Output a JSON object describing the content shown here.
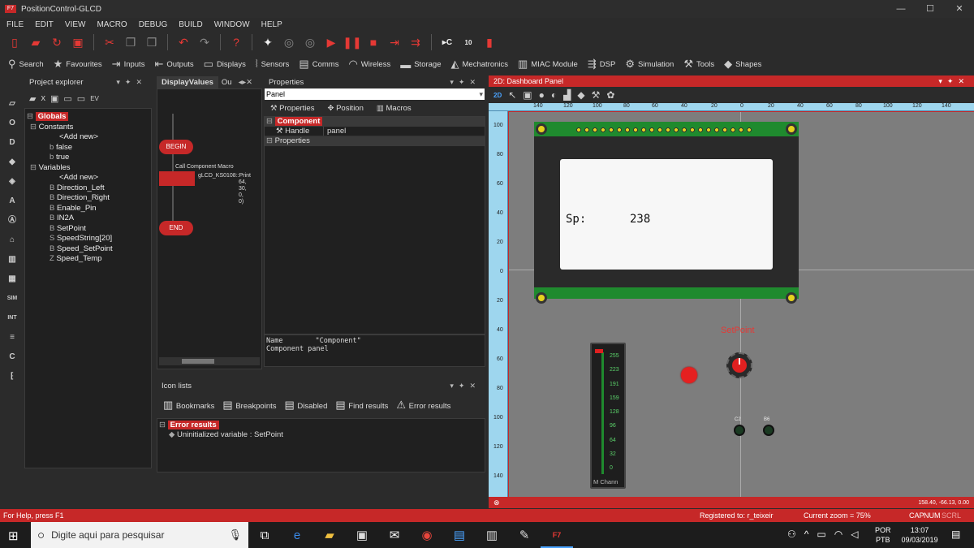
{
  "window": {
    "title": "PositionControl-GLCD",
    "min": "—",
    "max": "☐",
    "close": "✕"
  },
  "menu": [
    "FILE",
    "EDIT",
    "VIEW",
    "MACRO",
    "DEBUG",
    "BUILD",
    "WINDOW",
    "HELP"
  ],
  "toolbar2": [
    {
      "label": "Search",
      "icon": "search-icon"
    },
    {
      "label": "Favourites",
      "icon": "star-icon"
    },
    {
      "label": "Inputs",
      "icon": "inputs-icon"
    },
    {
      "label": "Outputs",
      "icon": "outputs-icon"
    },
    {
      "label": "Displays",
      "icon": "displays-icon"
    },
    {
      "label": "Sensors",
      "icon": "sensors-icon"
    },
    {
      "label": "Comms",
      "icon": "comms-icon"
    },
    {
      "label": "Wireless",
      "icon": "wireless-icon"
    },
    {
      "label": "Storage",
      "icon": "storage-icon"
    },
    {
      "label": "Mechatronics",
      "icon": "mechatronics-icon"
    },
    {
      "label": "MIAC Module",
      "icon": "miac-icon"
    },
    {
      "label": "DSP",
      "icon": "dsp-icon"
    },
    {
      "label": "Simulation",
      "icon": "gear-icon"
    },
    {
      "label": "Tools",
      "icon": "tools-icon"
    },
    {
      "label": "Shapes",
      "icon": "shapes-icon"
    }
  ],
  "project": {
    "title": "Project explorer",
    "globals": "Globals",
    "constants": "Constants",
    "const_items": [
      "<Add new>",
      "false",
      "true"
    ],
    "variables": "Variables",
    "var_items": [
      "<Add new>",
      "Direction_Left",
      "Direction_Right",
      "Enable_Pin",
      "IN2A",
      "SetPoint",
      "SpeedString[20]",
      "Speed_SetPoint",
      "Speed_Temp"
    ]
  },
  "flow": {
    "tab1": "DisplayValues",
    "tab2": "Ou",
    "begin": "BEGIN",
    "end": "END",
    "call_title": "Call Component Macro",
    "call_text": "gLCD_KS0108::Print",
    "call_args": [
      "64,",
      "30,",
      "0,",
      "0)"
    ]
  },
  "props": {
    "title": "Properties",
    "selected": "Panel",
    "tabs": [
      "Properties",
      "Position",
      "Macros"
    ],
    "component": "Component",
    "handle_label": "Handle",
    "handle_value": "panel",
    "properties": "Properties",
    "info_name": "Name",
    "info_value": "\"Component\"",
    "info_line2": "Component panel"
  },
  "iconlists": {
    "title": "Icon lists",
    "tabs": [
      "Bookmarks",
      "Breakpoints",
      "Disabled",
      "Find results",
      "Error results"
    ],
    "err_header": "Error results",
    "err_item": "Uninitialized variable : SetPoint"
  },
  "dashboard": {
    "title": "2D: Dashboard Panel",
    "mode": "2D",
    "hruler": [
      "140",
      "120",
      "100",
      "80",
      "60",
      "40",
      "20",
      "0",
      "20",
      "40",
      "60",
      "80",
      "100",
      "120",
      "140"
    ],
    "vruler": [
      "100",
      "80",
      "60",
      "40",
      "20",
      "0",
      "20",
      "40",
      "60",
      "80",
      "100",
      "120",
      "140"
    ],
    "lcd_label": "Sp:",
    "lcd_value": "238",
    "setpoint_label": "SetPoint",
    "meter_ticks": [
      "255",
      "223",
      "191",
      "159",
      "128",
      "96",
      "64",
      "32",
      "0"
    ],
    "meter_label": "M Chann",
    "led1": "C2",
    "led2": "B6",
    "coords": "158.40, -66.13, 0.00"
  },
  "status": {
    "help": "For Help, press F1",
    "registered": "Registered to: r_teixeir",
    "zoom": "Current zoom = 75%",
    "cap": "CAP",
    "num": "NUM",
    "scrl": "SCRL"
  },
  "taskbar": {
    "search": "Digite aqui para pesquisar",
    "lang1": "POR",
    "lang2": "PTB",
    "time": "13:07",
    "date": "09/03/2019"
  },
  "colors": {
    "accent": "#c62828",
    "lcd_green": "#1f8a2e",
    "lcd_screen": "#f7f7f7",
    "dash_bg": "#7d7d7d"
  }
}
